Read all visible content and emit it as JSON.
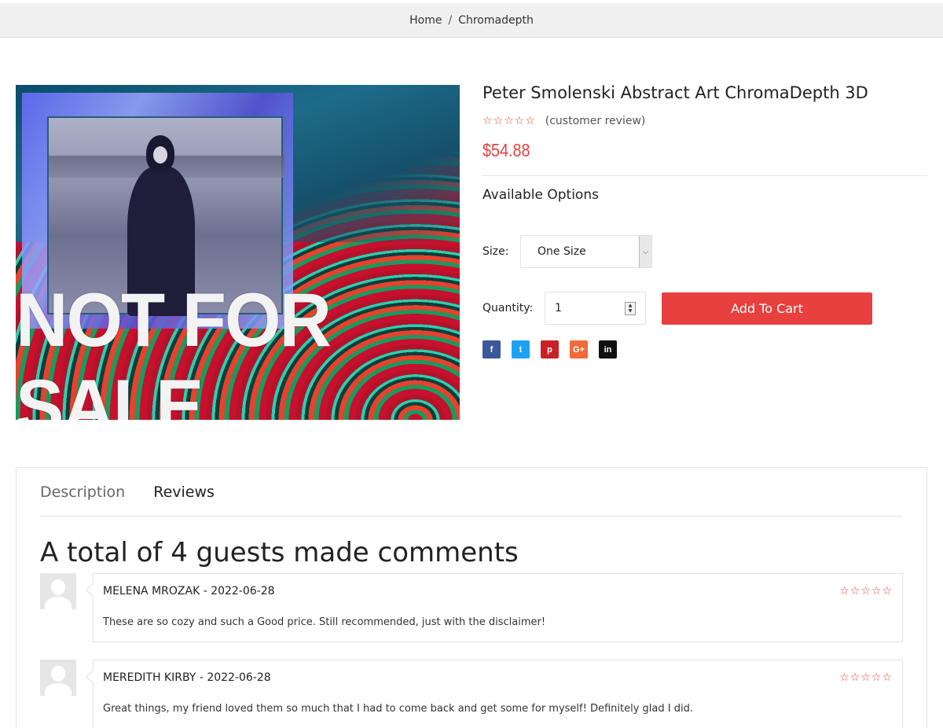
{
  "breadcrumb": {
    "home": "Home",
    "separator": "/",
    "current": "Chromadepth"
  },
  "product": {
    "image_text": "NOT FOR SALE",
    "title": "Peter Smolenski Abstract Art ChromaDepth 3D",
    "stars": "☆☆☆☆☆",
    "review_link": "(customer review)",
    "price": "$54.88",
    "available_options": "Available Options",
    "size_label": "Size:",
    "size_value": "One Size",
    "quantity_label": "Quantity:",
    "quantity_value": "1",
    "add_to_cart": "Add To Cart"
  },
  "social": [
    {
      "name": "facebook-icon",
      "glyph": "f",
      "color": "#3b5998"
    },
    {
      "name": "twitter-icon",
      "glyph": "t",
      "color": "#1da1f2"
    },
    {
      "name": "pinterest-icon",
      "glyph": "p",
      "color": "#cb2027"
    },
    {
      "name": "google-plus-icon",
      "glyph": "G+",
      "color": "#f06a3b"
    },
    {
      "name": "linkedin-icon",
      "glyph": "in",
      "color": "#111111"
    }
  ],
  "tabs": {
    "description": "Description",
    "reviews": "Reviews"
  },
  "comments": {
    "title": "A total of 4 guests made comments",
    "reviews": [
      {
        "header": "MELENA MROZAK - 2022-06-28",
        "stars": "☆☆☆☆☆",
        "text": "These are so cozy and such a Good price. Still recommended, just with the disclaimer!"
      },
      {
        "header": "MEREDITH KIRBY - 2022-06-28",
        "stars": "☆☆☆☆☆",
        "text": "Great things, my friend loved them so much that I had to come back and get some for myself! Definitely glad I did."
      }
    ]
  },
  "colors": {
    "accent": "#e8403f",
    "breadcrumb_bg": "#f0f0f0"
  }
}
